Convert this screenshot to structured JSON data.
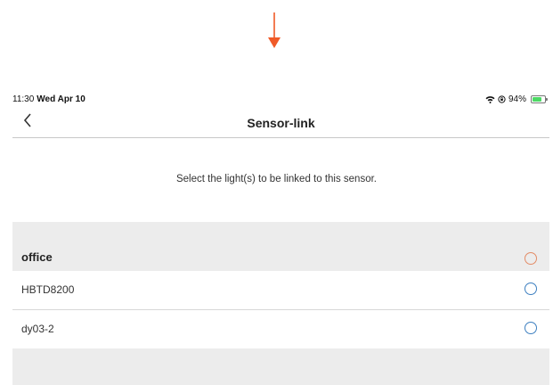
{
  "colors": {
    "accent_arrow": "#f05a28",
    "group_radio": "#e38b66",
    "item_radio": "#3d7fc0",
    "group_background": "#ececec"
  },
  "status_bar": {
    "time": "11:30",
    "date": "Wed Apr 10",
    "battery": "94%",
    "icons": [
      "wifi-icon",
      "orientation-lock-icon",
      "battery-charging-icon"
    ]
  },
  "nav": {
    "back_icon": "chevron-left-icon",
    "title": "Sensor-link"
  },
  "instruction": "Select the light(s) to be linked to this sensor.",
  "groups": [
    {
      "name": "office",
      "items": [
        {
          "label": "HBTD8200"
        },
        {
          "label": "dy03-2"
        }
      ]
    }
  ]
}
